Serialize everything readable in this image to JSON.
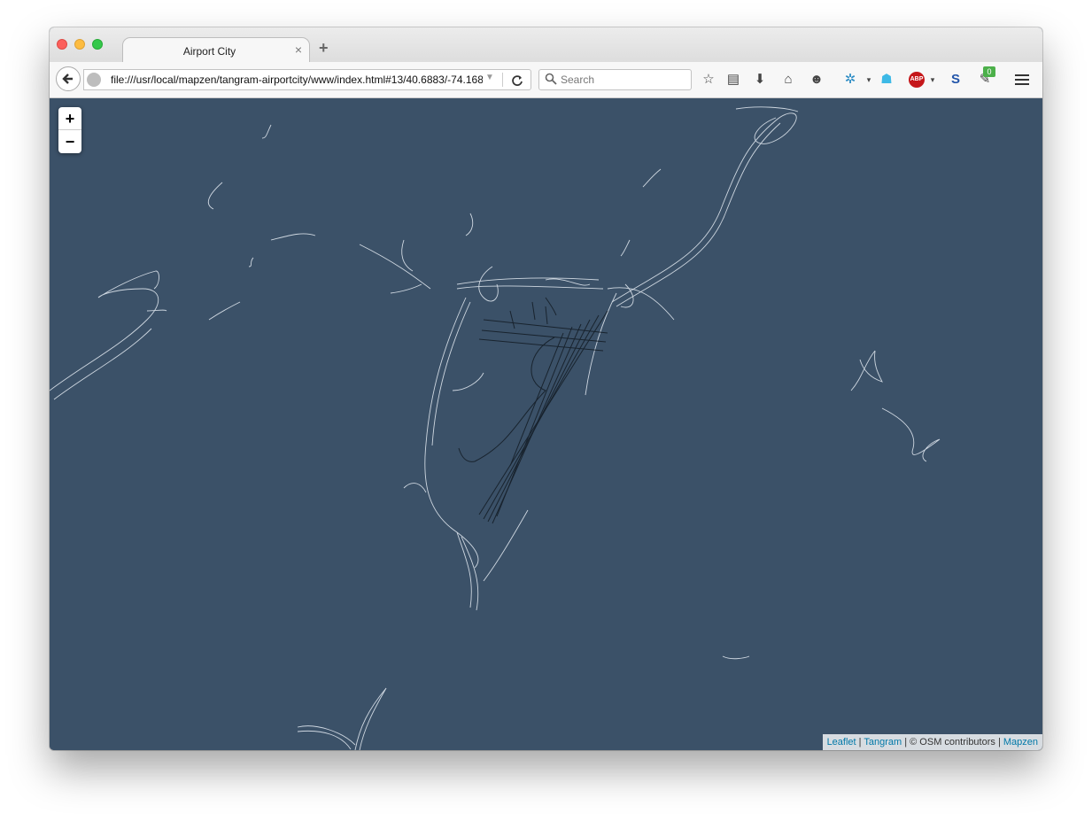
{
  "browser": {
    "tab_title": "Airport City",
    "tab_close": "×",
    "new_tab": "+",
    "url": "file:///usr/local/mapzen/tangram-airportcity/www/index.html#13/40.6883/-74.168",
    "search_placeholder": "Search",
    "addon_badge": "0",
    "abp_label": "ABP",
    "toolbar_icons": [
      "star-icon",
      "reading-list-icon",
      "download-icon",
      "home-icon",
      "emoji-icon",
      "network-icon",
      "ghostery-icon",
      "adblock-icon",
      "s-icon",
      "fox-icon",
      "menu-icon"
    ]
  },
  "map": {
    "background_color": "#3b5168",
    "road_color": "#dfe6ee",
    "runway_color": "#17212b",
    "zoom_in": "+",
    "zoom_out": "−",
    "attribution": {
      "leaflet": "Leaflet",
      "sep1": " | ",
      "tangram": "Tangram",
      "middle": " | © OSM contributors | ",
      "mapzen": "Mapzen"
    }
  }
}
